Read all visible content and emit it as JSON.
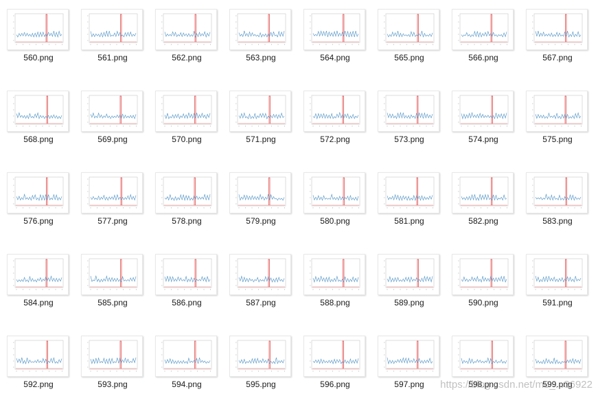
{
  "files": [
    {
      "name": "560.png"
    },
    {
      "name": "561.png"
    },
    {
      "name": "562.png"
    },
    {
      "name": "563.png"
    },
    {
      "name": "564.png"
    },
    {
      "name": "565.png"
    },
    {
      "name": "566.png"
    },
    {
      "name": "567.png"
    },
    {
      "name": "568.png"
    },
    {
      "name": "569.png"
    },
    {
      "name": "570.png"
    },
    {
      "name": "571.png"
    },
    {
      "name": "572.png"
    },
    {
      "name": "573.png"
    },
    {
      "name": "574.png"
    },
    {
      "name": "575.png"
    },
    {
      "name": "576.png"
    },
    {
      "name": "577.png"
    },
    {
      "name": "578.png"
    },
    {
      "name": "579.png"
    },
    {
      "name": "580.png"
    },
    {
      "name": "581.png"
    },
    {
      "name": "582.png"
    },
    {
      "name": "583.png"
    },
    {
      "name": "584.png"
    },
    {
      "name": "585.png"
    },
    {
      "name": "586.png"
    },
    {
      "name": "587.png"
    },
    {
      "name": "588.png"
    },
    {
      "name": "589.png"
    },
    {
      "name": "590.png"
    },
    {
      "name": "591.png"
    },
    {
      "name": "592.png"
    },
    {
      "name": "593.png"
    },
    {
      "name": "594.png"
    },
    {
      "name": "595.png"
    },
    {
      "name": "596.png"
    },
    {
      "name": "597.png"
    },
    {
      "name": "598.png"
    },
    {
      "name": "599.png"
    }
  ],
  "watermark": "https://blog.csdn.net/m0_...36922",
  "colors": {
    "signal_line": "#4a8fc4",
    "marker_line": "#e04040",
    "axis": "#c8c8c8"
  }
}
